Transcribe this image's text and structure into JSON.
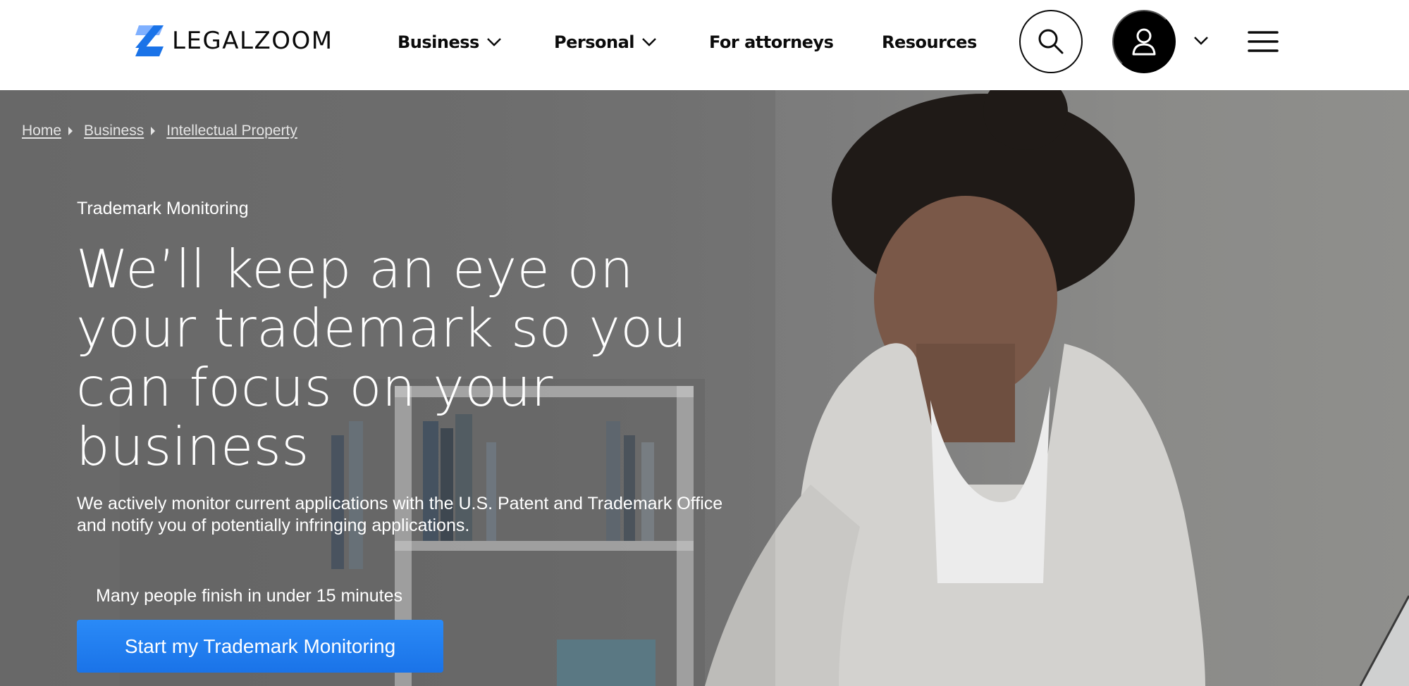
{
  "brand": {
    "name": "LEGALZOOM",
    "logo_icon": "legalzoom-z-logo",
    "accent_color": "#1a73e8"
  },
  "nav": {
    "items": [
      {
        "label": "Business",
        "has_dropdown": true
      },
      {
        "label": "Personal",
        "has_dropdown": true
      },
      {
        "label": "For attorneys",
        "has_dropdown": false
      },
      {
        "label": "Resources",
        "has_dropdown": false
      }
    ],
    "search_icon": "search-icon",
    "account_icon": "user-icon",
    "account_dropdown_icon": "chevron-down-icon",
    "menu_icon": "hamburger-menu-icon"
  },
  "breadcrumb": [
    {
      "label": "Home"
    },
    {
      "label": "Business"
    },
    {
      "label": "Intellectual Property"
    }
  ],
  "hero": {
    "eyebrow": "Trademark Monitoring",
    "headline": "We’ll keep an eye on your trademark so you can focus on your business",
    "description": "We actively monitor current applications with the U.S. Patent and Trademark Office and notify you of potentially infringing applications.",
    "note": "Many people finish in under 15 minutes",
    "cta_label": "Start my Trademark Monitoring"
  }
}
